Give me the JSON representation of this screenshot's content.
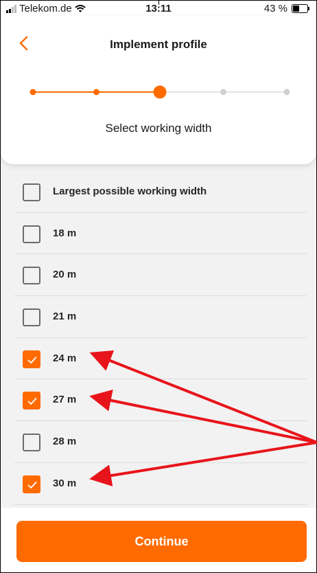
{
  "status_bar": {
    "carrier": "Telekom.de",
    "time": "13:11",
    "battery": "43 %",
    "battery_level": 0.43
  },
  "header": {
    "title": "Implement profile",
    "subtitle": "Select working width",
    "current_step": 3,
    "total_steps": 5
  },
  "options": [
    {
      "label": "Largest possible working width",
      "checked": false
    },
    {
      "label": "18 m",
      "checked": false
    },
    {
      "label": "20 m",
      "checked": false
    },
    {
      "label": "21 m",
      "checked": false
    },
    {
      "label": "24 m",
      "checked": true
    },
    {
      "label": "27 m",
      "checked": true
    },
    {
      "label": "28 m",
      "checked": false
    },
    {
      "label": "30 m",
      "checked": true
    }
  ],
  "footer": {
    "continue_label": "Continue"
  },
  "colors": {
    "accent": "#ff6b00",
    "annotation_arrow": "#e8141b"
  }
}
